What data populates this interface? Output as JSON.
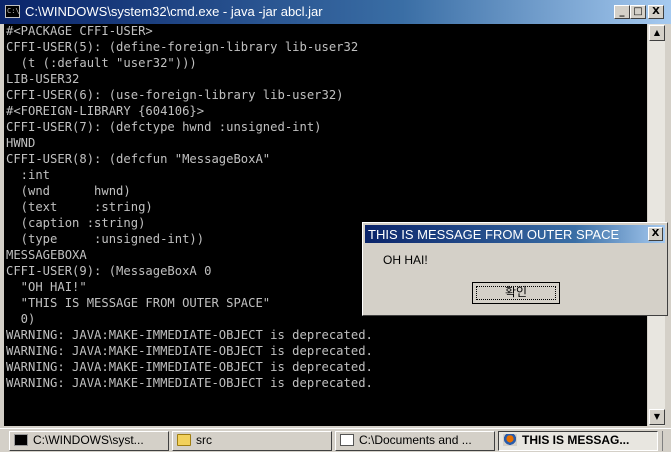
{
  "window": {
    "title": "C:\\WINDOWS\\system32\\cmd.exe - java -jar abcl.jar",
    "controls": {
      "minimize": "_",
      "maximize": "□",
      "close": "X"
    }
  },
  "console": {
    "lines": [
      "#<PACKAGE CFFI-USER>",
      "CFFI-USER(5): (define-foreign-library lib-user32",
      "  (t (:default \"user32\")))",
      "LIB-USER32",
      "CFFI-USER(6): (use-foreign-library lib-user32)",
      "#<FOREIGN-LIBRARY {604106}>",
      "CFFI-USER(7): (defctype hwnd :unsigned-int)",
      "HWND",
      "CFFI-USER(8): (defcfun \"MessageBoxA\"",
      "  :int",
      "  (wnd      hwnd)",
      "  (text     :string)",
      "  (caption :string)",
      "  (type     :unsigned-int))",
      "MESSAGEBOXA",
      "CFFI-USER(9): (MessageBoxA 0",
      "  \"OH HAI!\"",
      "  \"THIS IS MESSAGE FROM OUTER SPACE\"",
      "  0)",
      "WARNING: JAVA:MAKE-IMMEDIATE-OBJECT is deprecated.",
      "WARNING: JAVA:MAKE-IMMEDIATE-OBJECT is deprecated.",
      "WARNING: JAVA:MAKE-IMMEDIATE-OBJECT is deprecated.",
      "WARNING: JAVA:MAKE-IMMEDIATE-OBJECT is deprecated.",
      "",
      "",
      ""
    ],
    "scroll_up": "▲",
    "scroll_down": "▼"
  },
  "message_box": {
    "title": "THIS IS MESSAGE FROM OUTER SPACE",
    "close": "X",
    "text": "OH HAI!",
    "ok_label": "확인"
  },
  "taskbar": {
    "tasks": [
      {
        "label": "C:\\WINDOWS\\syst...",
        "icon": "cmd-icon"
      },
      {
        "label": "src",
        "icon": "folder-icon"
      },
      {
        "label": "C:\\Documents and ...",
        "icon": "notepad-icon"
      },
      {
        "label": "THIS IS MESSAG...",
        "icon": "java-icon"
      }
    ]
  },
  "colors": {
    "titlebar": "#0a246a",
    "console_bg": "#000000",
    "console_text": "#c0c0c0",
    "chrome": "#d4d0c8"
  }
}
